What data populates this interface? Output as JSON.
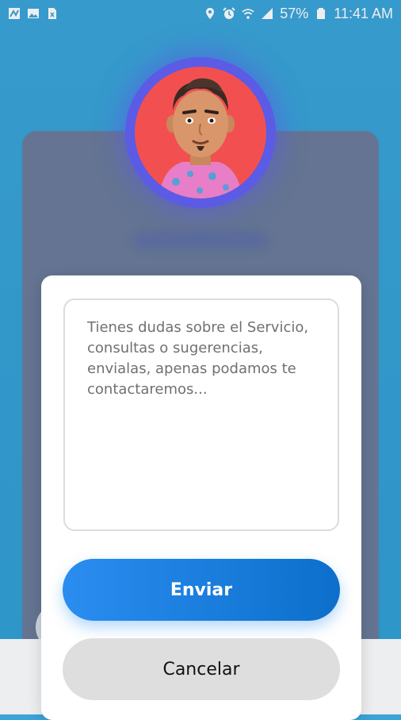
{
  "status_bar": {
    "battery_percent": "57%",
    "time": "11:41 AM",
    "left_icons": [
      "app-icon",
      "image-icon",
      "file-icon"
    ],
    "right_icons": [
      "location-icon",
      "alarm-icon",
      "wifi-icon",
      "signal-icon",
      "battery-icon"
    ]
  },
  "colors": {
    "background": "#3aa4d8",
    "avatar_ring": "#5b5be6",
    "avatar_bg": "#f25050",
    "send_button": "#1e7ddc",
    "cancel_button": "#dedede"
  },
  "profile": {
    "avatar_icon": "user-avatar"
  },
  "modal": {
    "message_placeholder": "Tienes dudas sobre el Servicio, consultas o sugerencias, envialas, apenas podamos te contactaremos...",
    "send_label": "Enviar",
    "cancel_label": "Cancelar"
  }
}
